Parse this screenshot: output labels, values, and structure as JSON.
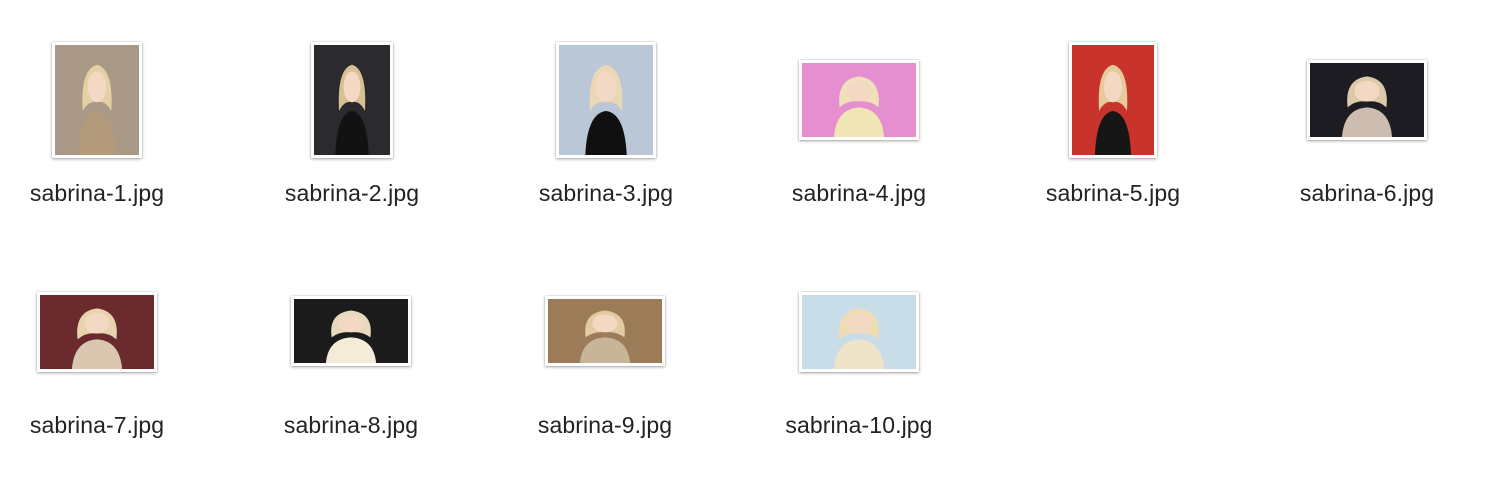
{
  "files": [
    {
      "name": "sabrina-1.jpg",
      "icon": "image-thumbnail-icon",
      "bg": "#a89a86",
      "figure": "#e7d3a3",
      "outfit": "#b39a7a"
    },
    {
      "name": "sabrina-2.jpg",
      "icon": "image-thumbnail-icon",
      "bg": "#2b2b2f",
      "figure": "#e3c89a",
      "outfit": "#121212"
    },
    {
      "name": "sabrina-3.jpg",
      "icon": "image-thumbnail-icon",
      "bg": "#b9c7d6",
      "figure": "#ecd8b4",
      "outfit": "#101010"
    },
    {
      "name": "sabrina-4.jpg",
      "icon": "image-thumbnail-icon",
      "bg": "#e58ed0",
      "figure": "#f1e6b9",
      "outfit": "#f0e5b4"
    },
    {
      "name": "sabrina-5.jpg",
      "icon": "image-thumbnail-icon",
      "bg": "#c8332b",
      "figure": "#ead2a4",
      "outfit": "#161616"
    },
    {
      "name": "sabrina-6.jpg",
      "icon": "image-thumbnail-icon",
      "bg": "#1c1c22",
      "figure": "#e7d3b0",
      "outfit": "#cdbcb0"
    },
    {
      "name": "sabrina-7.jpg",
      "icon": "image-thumbnail-icon",
      "bg": "#6a2a2e",
      "figure": "#f0dcb6",
      "outfit": "#d9c7b0"
    },
    {
      "name": "sabrina-8.jpg",
      "icon": "image-thumbnail-icon",
      "bg": "#1b1b1b",
      "figure": "#f1e4c6",
      "outfit": "#f4ecd8"
    },
    {
      "name": "sabrina-9.jpg",
      "icon": "image-thumbnail-icon",
      "bg": "#9c7b58",
      "figure": "#e8cfa4",
      "outfit": "#c7b59a"
    },
    {
      "name": "sabrina-10.jpg",
      "icon": "image-thumbnail-icon",
      "bg": "#c9dde9",
      "figure": "#f0dcaf",
      "outfit": "#efe3c8"
    }
  ]
}
